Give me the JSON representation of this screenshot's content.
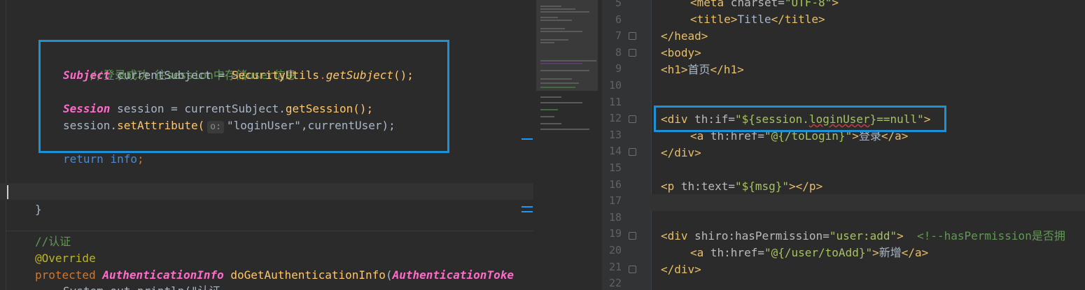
{
  "left_editor": {
    "lines": [
      {
        "type": "comment",
        "text": "//登录成功 往session中存储user信息"
      },
      {
        "type": "code1",
        "type_name": "Subject",
        "rest": " currentSubject = ",
        "cls": "SecurityUtils",
        "dot": ".",
        "method": "getSubject",
        "end": "();"
      },
      {
        "type": "code2",
        "type_name": "Session",
        "rest": " session = currentSubject.",
        "method": "getSession",
        "end": "();"
      },
      {
        "type": "code3",
        "obj": "session.",
        "method": "setAttribute",
        "open": "(",
        "hint": "o:",
        "str": "\"loginUser\"",
        "end": ",currentUser);"
      },
      {
        "type": "ret",
        "kw": "return",
        "var": "info",
        "end": ";"
      },
      {
        "type": "brace",
        "text": "}"
      },
      {
        "type": "comment2",
        "text": "//认证"
      },
      {
        "type": "annot",
        "text": "@Override"
      },
      {
        "type": "sig",
        "kw": "protected",
        "type_name": "AuthenticationInfo",
        "method": "doGetAuthenticationInfo",
        "open": "(",
        "arg": "AuthenticationToke"
      },
      {
        "type": "println",
        "text": "System.out.println(\"认证"
      }
    ]
  },
  "right_editor": {
    "line_numbers": [
      "5",
      "6",
      "7",
      "8",
      "9",
      "10",
      "11",
      "12",
      "13",
      "14",
      "15",
      "16",
      "17",
      "18",
      "19",
      "20",
      "21",
      "22"
    ],
    "meta_open": "<",
    "meta_tag": "meta",
    "meta_attr": " charset=",
    "meta_val": "\"UTF-8\"",
    "meta_close": ">",
    "title_open": "<title>",
    "title_text": "Title",
    "title_close": "</title>",
    "head_close": "</head>",
    "body_open": "<body>",
    "h1_open": "<h1>",
    "h1_text": "首页",
    "h1_close": "</h1>",
    "div1_tag": "<div",
    "div1_attr": " th:if=",
    "div1_val_pre": "\"${session.",
    "div1_val_var": "loginUser",
    "div1_val_post": "}==null\"",
    "div1_close": ">",
    "a1_tag": "<a",
    "a1_attr": " th:href=",
    "a1_val": "\"@{/toLogin}\"",
    "a1_close": ">",
    "a1_text": "登录",
    "a1_end": "</a>",
    "div_end": "</div>",
    "p_tag": "<p",
    "p_attr": " th:text=",
    "p_val": "\"${msg}\"",
    "p_close": "></p>",
    "div2_tag": "<div",
    "div2_attr": " shiro:hasPermission=",
    "div2_val": "\"user:add\"",
    "div2_close": ">",
    "div2_comment": "<!--hasPermission是否拥",
    "a2_tag": "<a",
    "a2_attr": " th:href=",
    "a2_val": "\"@{/user/toAdd}\"",
    "a2_close": ">",
    "a2_text": "新增",
    "a2_end": "</a>",
    "div3_end": "</div>"
  },
  "colors": {
    "highlight": "#1e90d6",
    "background": "#2b2b2b"
  }
}
